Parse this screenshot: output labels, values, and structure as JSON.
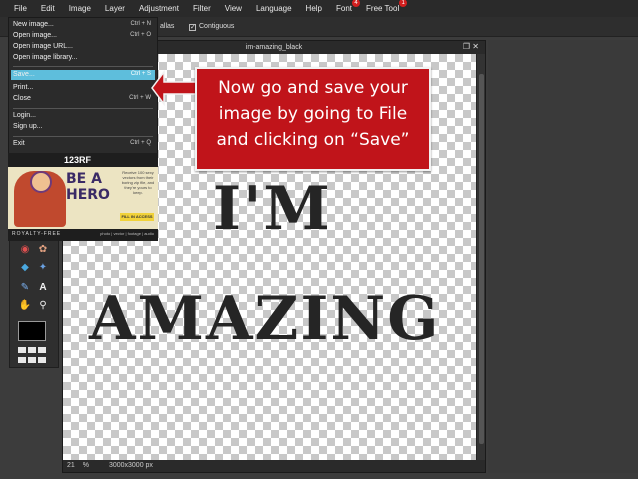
{
  "menubar": {
    "items": [
      "File",
      "Edit",
      "Image",
      "Layer",
      "Adjustment",
      "Filter",
      "View",
      "Language",
      "Help",
      "Font",
      "Free Tool"
    ],
    "font_badge": "4",
    "freetool_badge": "1"
  },
  "options": {
    "partial_label": "allas",
    "contiguous_label": "Contiguous"
  },
  "file_menu": {
    "items": [
      {
        "label": "New image...",
        "shortcut": "Ctrl + N"
      },
      {
        "label": "Open image...",
        "shortcut": "Ctrl + O"
      },
      {
        "label": "Open image URL...",
        "shortcut": ""
      },
      {
        "label": "Open image library...",
        "shortcut": ""
      },
      {
        "label": "Save...",
        "shortcut": "Ctrl + S"
      },
      {
        "label": "Print...",
        "shortcut": ""
      },
      {
        "label": "Close",
        "shortcut": "Ctrl + W"
      },
      {
        "label": "Login...",
        "shortcut": ""
      },
      {
        "label": "Sign up...",
        "shortcut": ""
      },
      {
        "label": "Exit",
        "shortcut": "Ctrl + Q"
      }
    ]
  },
  "ad": {
    "logo": "123RF",
    "headline_1": "BE A",
    "headline_2": "HERO",
    "tagline": "Receive 100 sexy vectors from their boring zip file, and they're yours to keep.",
    "cta": "FILL IN ACCESS",
    "footer_left": "ROYALTY-FREE",
    "footer_right": "photo | vector | footage | audio"
  },
  "document": {
    "title": "im-amazing_black",
    "line1": "I'M",
    "line2": "AMAZING",
    "zoom": "21",
    "zoom_unit": "%",
    "size": "3000x3000 px"
  },
  "callout": {
    "line1": "Now go and save your",
    "line2": "image by going to File",
    "line3": "and clicking on “Save”"
  },
  "colors": {
    "callout_bg": "#c0141a",
    "highlight": "#5ebedc",
    "foreground_color": "#000000"
  }
}
